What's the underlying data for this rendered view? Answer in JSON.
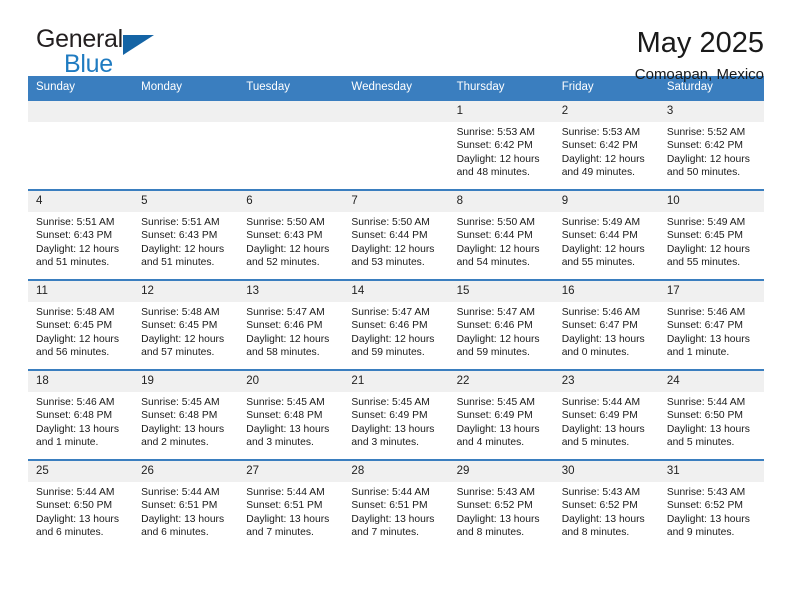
{
  "logo": {
    "text_top": "General",
    "text_bottom": "Blue",
    "accent_color": "#1464a5",
    "blue_text_color": "#1f7bc1"
  },
  "header": {
    "title": "May 2025",
    "subtitle": "Comoapan, Mexico"
  },
  "theme": {
    "header_row_bg": "#3a7ebf",
    "daynum_bg": "#f0f0f0",
    "row_border": "#3a7ebf"
  },
  "weekdays": [
    "Sunday",
    "Monday",
    "Tuesday",
    "Wednesday",
    "Thursday",
    "Friday",
    "Saturday"
  ],
  "weeks": [
    [
      {
        "day": "",
        "sunrise": "",
        "sunset": "",
        "daylight_line1": "",
        "daylight_line2": ""
      },
      {
        "day": "",
        "sunrise": "",
        "sunset": "",
        "daylight_line1": "",
        "daylight_line2": ""
      },
      {
        "day": "",
        "sunrise": "",
        "sunset": "",
        "daylight_line1": "",
        "daylight_line2": ""
      },
      {
        "day": "",
        "sunrise": "",
        "sunset": "",
        "daylight_line1": "",
        "daylight_line2": ""
      },
      {
        "day": "1",
        "sunrise": "Sunrise: 5:53 AM",
        "sunset": "Sunset: 6:42 PM",
        "daylight_line1": "Daylight: 12 hours",
        "daylight_line2": "and 48 minutes."
      },
      {
        "day": "2",
        "sunrise": "Sunrise: 5:53 AM",
        "sunset": "Sunset: 6:42 PM",
        "daylight_line1": "Daylight: 12 hours",
        "daylight_line2": "and 49 minutes."
      },
      {
        "day": "3",
        "sunrise": "Sunrise: 5:52 AM",
        "sunset": "Sunset: 6:42 PM",
        "daylight_line1": "Daylight: 12 hours",
        "daylight_line2": "and 50 minutes."
      }
    ],
    [
      {
        "day": "4",
        "sunrise": "Sunrise: 5:51 AM",
        "sunset": "Sunset: 6:43 PM",
        "daylight_line1": "Daylight: 12 hours",
        "daylight_line2": "and 51 minutes."
      },
      {
        "day": "5",
        "sunrise": "Sunrise: 5:51 AM",
        "sunset": "Sunset: 6:43 PM",
        "daylight_line1": "Daylight: 12 hours",
        "daylight_line2": "and 51 minutes."
      },
      {
        "day": "6",
        "sunrise": "Sunrise: 5:50 AM",
        "sunset": "Sunset: 6:43 PM",
        "daylight_line1": "Daylight: 12 hours",
        "daylight_line2": "and 52 minutes."
      },
      {
        "day": "7",
        "sunrise": "Sunrise: 5:50 AM",
        "sunset": "Sunset: 6:44 PM",
        "daylight_line1": "Daylight: 12 hours",
        "daylight_line2": "and 53 minutes."
      },
      {
        "day": "8",
        "sunrise": "Sunrise: 5:50 AM",
        "sunset": "Sunset: 6:44 PM",
        "daylight_line1": "Daylight: 12 hours",
        "daylight_line2": "and 54 minutes."
      },
      {
        "day": "9",
        "sunrise": "Sunrise: 5:49 AM",
        "sunset": "Sunset: 6:44 PM",
        "daylight_line1": "Daylight: 12 hours",
        "daylight_line2": "and 55 minutes."
      },
      {
        "day": "10",
        "sunrise": "Sunrise: 5:49 AM",
        "sunset": "Sunset: 6:45 PM",
        "daylight_line1": "Daylight: 12 hours",
        "daylight_line2": "and 55 minutes."
      }
    ],
    [
      {
        "day": "11",
        "sunrise": "Sunrise: 5:48 AM",
        "sunset": "Sunset: 6:45 PM",
        "daylight_line1": "Daylight: 12 hours",
        "daylight_line2": "and 56 minutes."
      },
      {
        "day": "12",
        "sunrise": "Sunrise: 5:48 AM",
        "sunset": "Sunset: 6:45 PM",
        "daylight_line1": "Daylight: 12 hours",
        "daylight_line2": "and 57 minutes."
      },
      {
        "day": "13",
        "sunrise": "Sunrise: 5:47 AM",
        "sunset": "Sunset: 6:46 PM",
        "daylight_line1": "Daylight: 12 hours",
        "daylight_line2": "and 58 minutes."
      },
      {
        "day": "14",
        "sunrise": "Sunrise: 5:47 AM",
        "sunset": "Sunset: 6:46 PM",
        "daylight_line1": "Daylight: 12 hours",
        "daylight_line2": "and 59 minutes."
      },
      {
        "day": "15",
        "sunrise": "Sunrise: 5:47 AM",
        "sunset": "Sunset: 6:46 PM",
        "daylight_line1": "Daylight: 12 hours",
        "daylight_line2": "and 59 minutes."
      },
      {
        "day": "16",
        "sunrise": "Sunrise: 5:46 AM",
        "sunset": "Sunset: 6:47 PM",
        "daylight_line1": "Daylight: 13 hours",
        "daylight_line2": "and 0 minutes."
      },
      {
        "day": "17",
        "sunrise": "Sunrise: 5:46 AM",
        "sunset": "Sunset: 6:47 PM",
        "daylight_line1": "Daylight: 13 hours",
        "daylight_line2": "and 1 minute."
      }
    ],
    [
      {
        "day": "18",
        "sunrise": "Sunrise: 5:46 AM",
        "sunset": "Sunset: 6:48 PM",
        "daylight_line1": "Daylight: 13 hours",
        "daylight_line2": "and 1 minute."
      },
      {
        "day": "19",
        "sunrise": "Sunrise: 5:45 AM",
        "sunset": "Sunset: 6:48 PM",
        "daylight_line1": "Daylight: 13 hours",
        "daylight_line2": "and 2 minutes."
      },
      {
        "day": "20",
        "sunrise": "Sunrise: 5:45 AM",
        "sunset": "Sunset: 6:48 PM",
        "daylight_line1": "Daylight: 13 hours",
        "daylight_line2": "and 3 minutes."
      },
      {
        "day": "21",
        "sunrise": "Sunrise: 5:45 AM",
        "sunset": "Sunset: 6:49 PM",
        "daylight_line1": "Daylight: 13 hours",
        "daylight_line2": "and 3 minutes."
      },
      {
        "day": "22",
        "sunrise": "Sunrise: 5:45 AM",
        "sunset": "Sunset: 6:49 PM",
        "daylight_line1": "Daylight: 13 hours",
        "daylight_line2": "and 4 minutes."
      },
      {
        "day": "23",
        "sunrise": "Sunrise: 5:44 AM",
        "sunset": "Sunset: 6:49 PM",
        "daylight_line1": "Daylight: 13 hours",
        "daylight_line2": "and 5 minutes."
      },
      {
        "day": "24",
        "sunrise": "Sunrise: 5:44 AM",
        "sunset": "Sunset: 6:50 PM",
        "daylight_line1": "Daylight: 13 hours",
        "daylight_line2": "and 5 minutes."
      }
    ],
    [
      {
        "day": "25",
        "sunrise": "Sunrise: 5:44 AM",
        "sunset": "Sunset: 6:50 PM",
        "daylight_line1": "Daylight: 13 hours",
        "daylight_line2": "and 6 minutes."
      },
      {
        "day": "26",
        "sunrise": "Sunrise: 5:44 AM",
        "sunset": "Sunset: 6:51 PM",
        "daylight_line1": "Daylight: 13 hours",
        "daylight_line2": "and 6 minutes."
      },
      {
        "day": "27",
        "sunrise": "Sunrise: 5:44 AM",
        "sunset": "Sunset: 6:51 PM",
        "daylight_line1": "Daylight: 13 hours",
        "daylight_line2": "and 7 minutes."
      },
      {
        "day": "28",
        "sunrise": "Sunrise: 5:44 AM",
        "sunset": "Sunset: 6:51 PM",
        "daylight_line1": "Daylight: 13 hours",
        "daylight_line2": "and 7 minutes."
      },
      {
        "day": "29",
        "sunrise": "Sunrise: 5:43 AM",
        "sunset": "Sunset: 6:52 PM",
        "daylight_line1": "Daylight: 13 hours",
        "daylight_line2": "and 8 minutes."
      },
      {
        "day": "30",
        "sunrise": "Sunrise: 5:43 AM",
        "sunset": "Sunset: 6:52 PM",
        "daylight_line1": "Daylight: 13 hours",
        "daylight_line2": "and 8 minutes."
      },
      {
        "day": "31",
        "sunrise": "Sunrise: 5:43 AM",
        "sunset": "Sunset: 6:52 PM",
        "daylight_line1": "Daylight: 13 hours",
        "daylight_line2": "and 9 minutes."
      }
    ]
  ]
}
